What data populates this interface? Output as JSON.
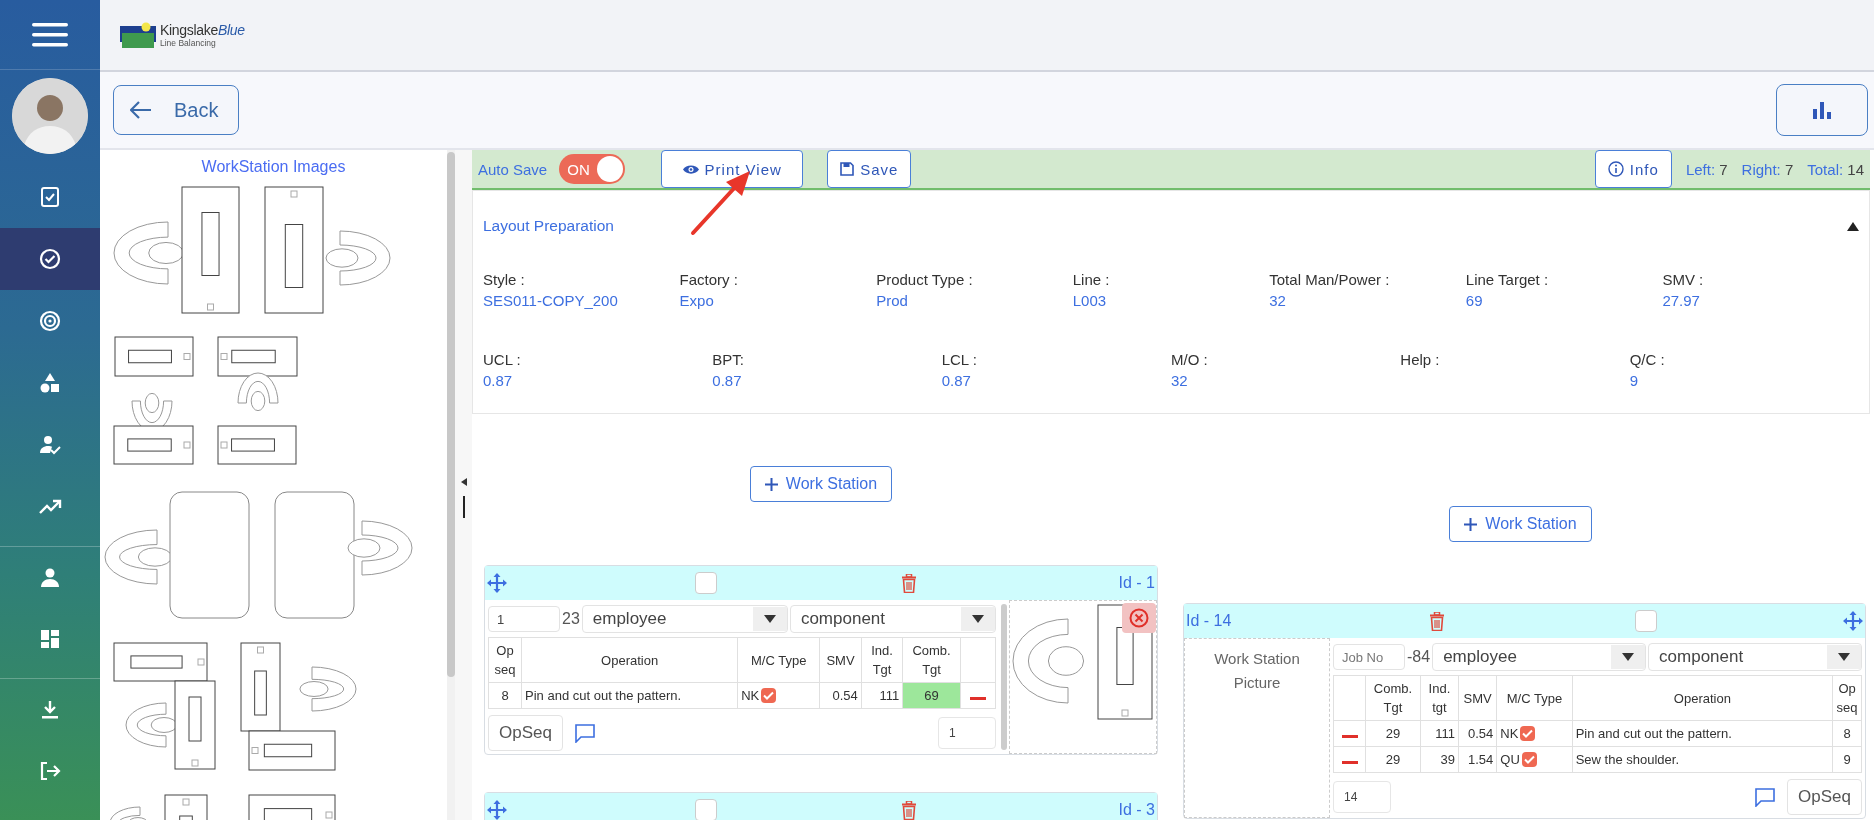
{
  "sidebar": {
    "items": [
      {
        "selected": false
      },
      {
        "selected": true
      },
      {
        "selected": false
      },
      {
        "selected": false
      },
      {
        "selected": false
      },
      {
        "selected": false
      },
      {
        "selected": false
      },
      {
        "selected": false
      },
      {
        "selected": false
      },
      {
        "selected": false
      }
    ]
  },
  "header": {
    "brand": "Kingslake",
    "brand_accent": "Blue",
    "subtitle": "Line Balancing"
  },
  "back_button": "Back",
  "left_panel": {
    "title": "WorkStation Images"
  },
  "toolbar": {
    "auto_save_label": "Auto Save",
    "auto_save": {
      "on": true,
      "text": "ON"
    },
    "print_view": "Print View",
    "save": "Save",
    "info": "Info",
    "counts": [
      {
        "label": "Left:",
        "value": "7"
      },
      {
        "label": "Right:",
        "value": "7"
      },
      {
        "label": "Total:",
        "value": "14"
      }
    ]
  },
  "layout": {
    "title": "Layout Preparation",
    "expanded": true,
    "fields_row1": [
      {
        "label": "Style :",
        "value": "SES011-COPY_200"
      },
      {
        "label": "Factory :",
        "value": "Expo"
      },
      {
        "label": "Product Type :",
        "value": "Prod"
      },
      {
        "label": "Line :",
        "value": "L003"
      },
      {
        "label": "Total Man/Power :",
        "value": "32"
      },
      {
        "label": "Line Target :",
        "value": "69"
      },
      {
        "label": "SMV :",
        "value": "27.97"
      }
    ],
    "fields_row2": [
      {
        "label": "UCL :",
        "value": "0.87"
      },
      {
        "label": "BPT:",
        "value": "0.87"
      },
      {
        "label": "LCL :",
        "value": "0.87"
      },
      {
        "label": "M/O :",
        "value": "32"
      },
      {
        "label": "Help :"
      },
      {
        "label": "Q/C :",
        "value": "9"
      }
    ]
  },
  "columns": [
    {
      "kind": "left",
      "add_button": "Work Station",
      "cards": [
        {
          "id_label": "Id - 1",
          "checked": false,
          "job_no": {
            "value": "1"
          },
          "suffix": "23",
          "employee": "employee",
          "component": "component",
          "columns": [
            {
              "kind": "opseq",
              "label": "Op seq"
            },
            {
              "kind": "operation",
              "label": "Operation"
            },
            {
              "kind": "mctype",
              "label": "M/C Type"
            },
            {
              "kind": "smv",
              "label": "SMV"
            },
            {
              "kind": "indtgt",
              "label": "Ind. Tgt"
            },
            {
              "kind": "combtgt",
              "label": "Comb. Tgt"
            },
            {
              "kind": "remove"
            }
          ],
          "rows": [
            {
              "op_seq": "8",
              "operation": "Pin and cut out the pattern.",
              "mc_type": "NK",
              "mc_checked": true,
              "smv": "0.54",
              "ind_tgt": "111",
              "comb_tgt": "69",
              "comb_highlight": true
            }
          ],
          "opseq_button": "OpSeq",
          "count_field": "1",
          "picture": {
            "kind": "workstation"
          }
        },
        {
          "id_label": "Id - 3",
          "checked": false
        }
      ]
    },
    {
      "kind": "right",
      "add_button": "Work Station",
      "cards": [
        {
          "id_label": "Id - 14",
          "checked": false,
          "job_no": {
            "placeholder": "Job No"
          },
          "suffix": "-84",
          "employee": "employee",
          "component": "component",
          "columns": [
            {
              "kind": "remove"
            },
            {
              "kind": "combtgt",
              "label": "Comb. Tgt"
            },
            {
              "kind": "indtgt",
              "label": "Ind. tgt"
            },
            {
              "kind": "smv",
              "label": "SMV"
            },
            {
              "kind": "mctype",
              "label": "M/C Type"
            },
            {
              "kind": "operation",
              "label": "Operation"
            },
            {
              "kind": "opseq",
              "label": "Op seq"
            }
          ],
          "rows": [
            {
              "op_seq": "8",
              "operation": "Pin and cut out the pattern.",
              "mc_type": "NK",
              "mc_checked": true,
              "smv": "0.54",
              "ind_tgt": "111",
              "comb_tgt": "29",
              "comb_highlight": false
            },
            {
              "op_seq": "9",
              "operation": "Sew the shoulder.",
              "mc_type": "QU",
              "mc_checked": true,
              "smv": "1.54",
              "ind_tgt": "39",
              "comb_tgt": "29",
              "comb_highlight": false
            }
          ],
          "opseq_button": "OpSeq",
          "count_field": "14",
          "picture_label": "Work Station Picture"
        }
      ]
    }
  ]
}
